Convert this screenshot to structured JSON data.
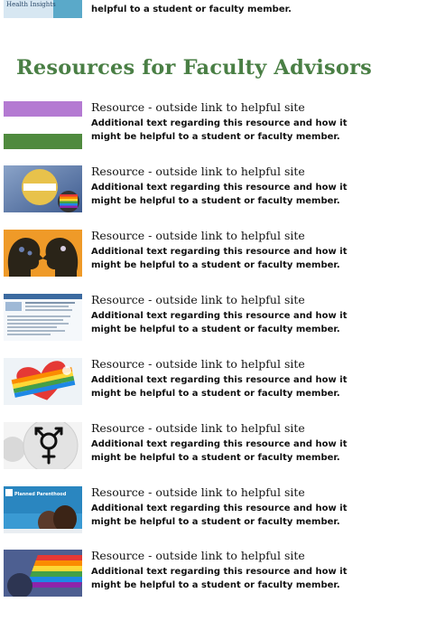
{
  "colors": {
    "heading": "#4a7f45",
    "text": "#111111",
    "purple_band": "#b47ad2",
    "green_band": "#4f8a3e",
    "orange": "#ef9a28"
  },
  "top_item": {
    "description": "helpful to a student or faculty member.",
    "image_caption": "Health Insights",
    "image_icon": "cropped-banner-image"
  },
  "section": {
    "heading": "Resources for Faculty Advisors"
  },
  "resources": [
    {
      "title": "Resource - outside link to helpful site",
      "description": "Additional text regarding this resource and how it might be helpful to a student or faculty member.",
      "image_icon": "purple-green-flag-image"
    },
    {
      "title": "Resource - outside link to helpful site",
      "description": "Additional text regarding this resource and how it might be helpful to a student or faculty member.",
      "image_icon": "pride-buttons-image"
    },
    {
      "title": "Resource - outside link to helpful site",
      "description": "Additional text regarding this resource and how it might be helpful to a student or faculty member.",
      "image_icon": "heads-silhouette-image"
    },
    {
      "title": "Resource - outside link to helpful site",
      "description": "Additional text regarding this resource and how it might be helpful to a student or faculty member.",
      "image_icon": "website-screenshot-image"
    },
    {
      "title": "Resource - outside link to helpful site",
      "description": "Additional text regarding this resource and how it might be helpful to a student or faculty member.",
      "image_icon": "rainbow-heart-image"
    },
    {
      "title": "Resource - outside link to helpful site",
      "description": "Additional text regarding this resource and how it might be helpful to a student or faculty member.",
      "image_icon": "transgender-symbol-button-image"
    },
    {
      "title": "Resource - outside link to helpful site",
      "description": "Additional text regarding this resource and how it might be helpful to a student or faculty member.",
      "image_icon": "planned-parenthood-banner-image",
      "image_text": "Planned Parenthood"
    },
    {
      "title": "Resource - outside link to helpful site",
      "description": "Additional text regarding this resource and how it might be helpful to a student or faculty member.",
      "image_icon": "rainbow-flag-image"
    }
  ]
}
